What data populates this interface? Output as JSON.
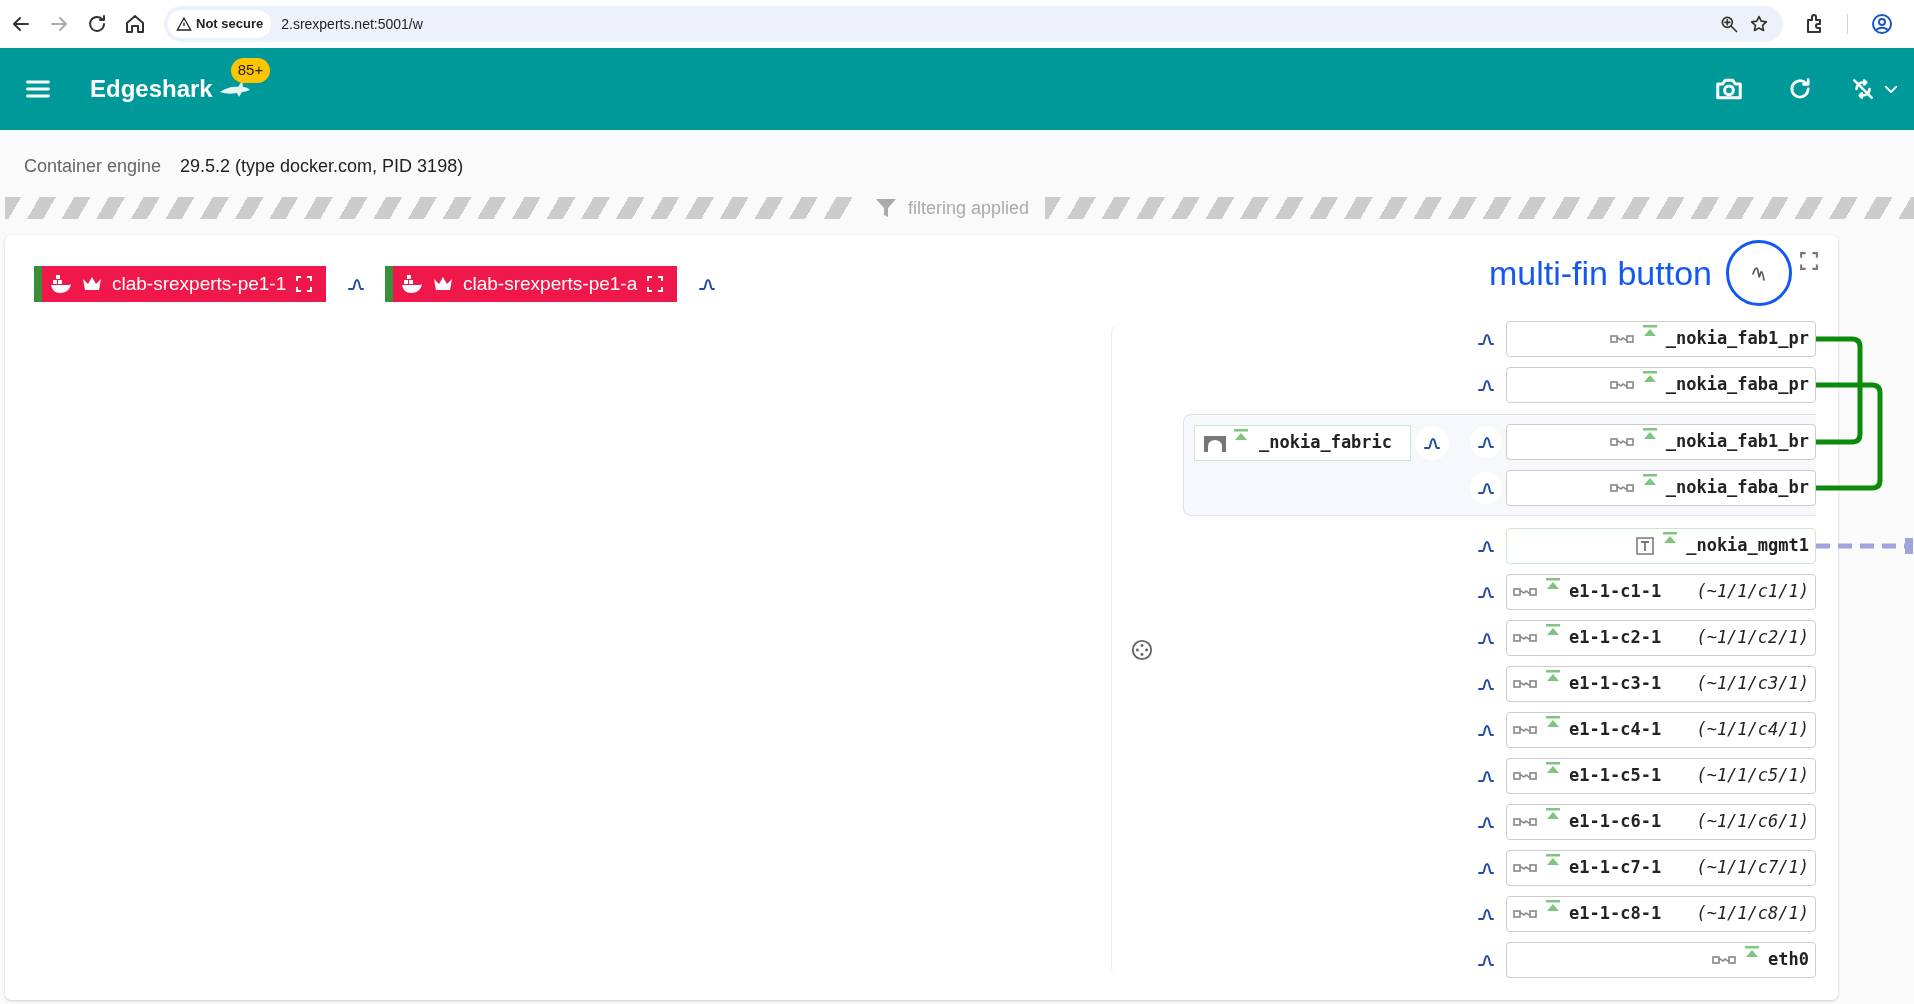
{
  "browser": {
    "security": "Not secure",
    "url": "2.srexperts.net:5001/w"
  },
  "app": {
    "title": "Edgeshark",
    "badge": "85+"
  },
  "engines": [
    {
      "label": "Container engine",
      "value": "29.5.2 (type docker.com, PID 3198)"
    }
  ],
  "filter": {
    "label": "filtering applied"
  },
  "pods": [
    {
      "name": "clab-srexperts-pe1-1"
    },
    {
      "name": "clab-srexperts-pe1-a"
    }
  ],
  "annotation": "multi-fin button",
  "interfaces": [
    {
      "name": "_nokia_fab1_pr",
      "kind": "veth",
      "up": true,
      "link": {
        "kind": "inner"
      }
    },
    {
      "name": "_nokia_faba_pr",
      "kind": "veth",
      "up": true,
      "link": {
        "kind": "outer"
      }
    },
    {
      "name": "_nokia_fabric",
      "kind": "bridge",
      "up": true,
      "children": [
        {
          "name": "_nokia_fab1_br",
          "kind": "veth",
          "up": true,
          "link": {
            "kind": "inner"
          }
        },
        {
          "name": "_nokia_faba_br",
          "kind": "veth",
          "up": true,
          "link": {
            "kind": "outer"
          }
        }
      ]
    },
    {
      "name": "_nokia_mgmt1",
      "kind": "tun",
      "up": true,
      "link": {
        "kind": "external"
      }
    },
    {
      "name": "e1-1-c1-1",
      "alias": "(~1/1/c1/1)",
      "kind": "veth",
      "up": true
    },
    {
      "name": "e1-1-c2-1",
      "alias": "(~1/1/c2/1)",
      "kind": "veth",
      "up": true
    },
    {
      "name": "e1-1-c3-1",
      "alias": "(~1/1/c3/1)",
      "kind": "veth",
      "up": true
    },
    {
      "name": "e1-1-c4-1",
      "alias": "(~1/1/c4/1)",
      "kind": "veth",
      "up": true
    },
    {
      "name": "e1-1-c5-1",
      "alias": "(~1/1/c5/1)",
      "kind": "veth",
      "up": true
    },
    {
      "name": "e1-1-c6-1",
      "alias": "(~1/1/c6/1)",
      "kind": "veth",
      "up": true
    },
    {
      "name": "e1-1-c7-1",
      "alias": "(~1/1/c7/1)",
      "kind": "veth",
      "up": true
    },
    {
      "name": "e1-1-c8-1",
      "alias": "(~1/1/c8/1)",
      "kind": "veth",
      "up": true
    },
    {
      "name": "eth0",
      "kind": "veth",
      "up": true
    }
  ]
}
